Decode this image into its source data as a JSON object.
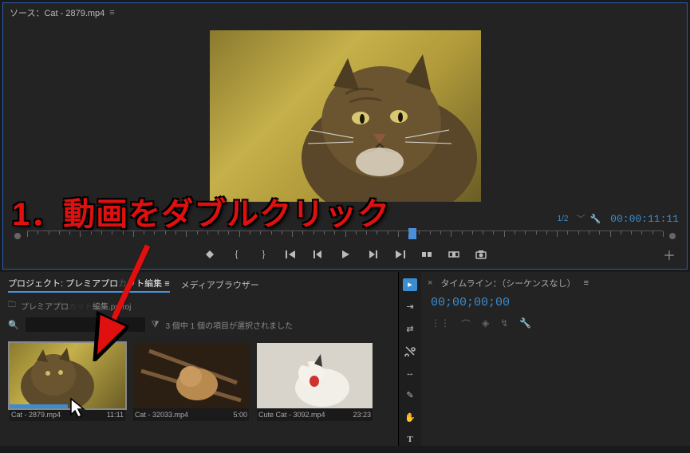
{
  "source": {
    "title": "ソース：Cat - 2879.mp4",
    "scale": "1/2",
    "timecode": "00:00:11:11"
  },
  "transport": {
    "btn_mark": "●",
    "btn_inpoint": "{",
    "btn_outpoint": "}",
    "btn_goto_in": "|←",
    "btn_step_back": "◀|",
    "btn_play": "▶",
    "btn_step_fwd": "|▶",
    "btn_goto_out": "→|",
    "btn_insert": "⊞",
    "btn_overwrite": "⊟",
    "btn_export": "📷"
  },
  "project": {
    "tab_active": "プロジェクト: プレミアプロ",
    "tab_active_suffix": "ット編集",
    "tab_media": "メディアブラウザー",
    "sub": "プレミアプロ",
    "sub_suffix": "編集.prproj",
    "status": "3 個中 1 個の項目が選択されました",
    "search_placeholder": "",
    "clips": [
      {
        "name": "Cat - 2879.mp4",
        "dur": "11:11"
      },
      {
        "name": "Cat - 32033.mp4",
        "dur": "5:00"
      },
      {
        "name": "Cute Cat - 3092.mp4",
        "dur": "23:23"
      }
    ]
  },
  "timeline": {
    "title": "タイムライン：（シーケンスなし）",
    "timecode": "00;00;00;00"
  },
  "annotation": {
    "step1": "1．動画をダブルクリック"
  },
  "icons": {
    "menu": "≡",
    "wrench": "🔧",
    "plus": "＋",
    "bin": "🗀",
    "search": "🔍",
    "funnel": "⧩",
    "close": "×",
    "snap": "⊓",
    "link": "⌒",
    "marker": "◈",
    "wrench2": "↯",
    "tools": {
      "selection": "▸",
      "track_select": "⇥",
      "ripple": "⇄",
      "razor": "✂",
      "slip": "↔",
      "pen": "✎",
      "hand": "✋",
      "type": "T"
    }
  }
}
